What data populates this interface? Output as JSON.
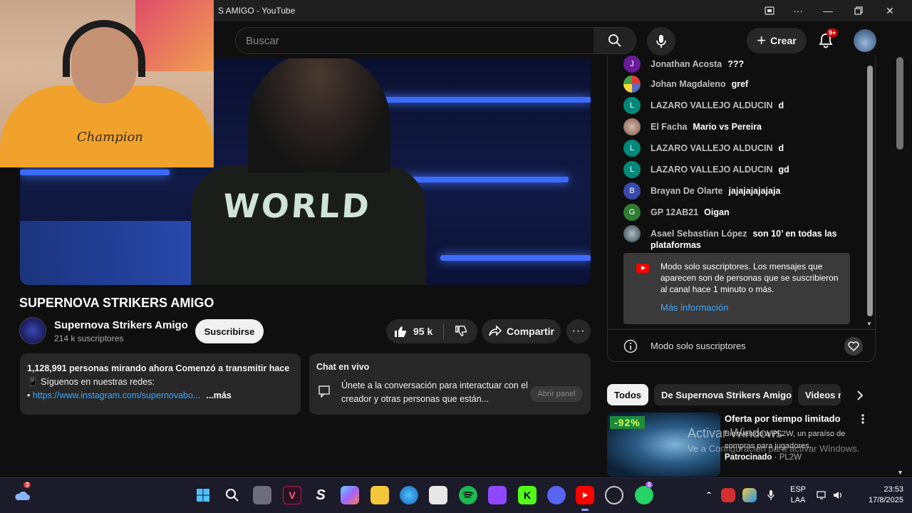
{
  "window": {
    "title": "S AMIGO - YouTube"
  },
  "header": {
    "search_placeholder": "Buscar",
    "create_label": "Crear",
    "notifications_badge": "9+"
  },
  "video": {
    "shirt_text": "WORLD",
    "webcam_brand": "Champion",
    "title": "SUPERNOVA STRIKERS AMIGO",
    "channel_name": "Supernova Strikers Amigo",
    "subscribers": "214 k suscriptores",
    "subscribe_label": "Suscribirse",
    "likes": "95 k",
    "share_label": "Compartir"
  },
  "description": {
    "stats": "1,128,991 personas mirando ahora  Comenzó a transmitir hace",
    "line2": "📱 Síguenos en nuestras redes:",
    "link": "https://www.instagram.com/supernovabo...",
    "more": "...más"
  },
  "chat_panel": {
    "title": "Chat en vivo",
    "message": "Únete a la conversación para interactuar con el creador y otras personas que están...",
    "open_label": "Abrir panel"
  },
  "live_chat": {
    "messages": [
      {
        "initial": "J",
        "author": "Jonathan Acosta",
        "text": "???",
        "color": "#6a1b9a"
      },
      {
        "initial": "",
        "author": "Johan Magdaleno",
        "text": "gref",
        "color": "#5c6bc0"
      },
      {
        "initial": "L",
        "author": "LAZARO VALLEJO ALDUCIN",
        "text": "d",
        "color": "#00897b"
      },
      {
        "initial": "",
        "author": "El Facha",
        "text": "Mario vs Pereira",
        "color": "#a1887f"
      },
      {
        "initial": "L",
        "author": "LAZARO VALLEJO ALDUCIN",
        "text": "d",
        "color": "#00897b"
      },
      {
        "initial": "L",
        "author": "LAZARO VALLEJO ALDUCIN",
        "text": "gd",
        "color": "#00897b"
      },
      {
        "initial": "B",
        "author": "Brayan De Olarte",
        "text": "jajajajajajaja",
        "color": "#3949ab"
      },
      {
        "initial": "G",
        "author": "GP 12AB21",
        "text": "Oigan",
        "color": "#2e7d32"
      },
      {
        "initial": "",
        "author": "Asael Sebastian López",
        "text": "son 10’ en todas las plataformas",
        "color": "#546e7a"
      }
    ],
    "notice_text": "Modo solo suscriptores. Los mensajes que aparecen son de personas que se suscribieron al canal hace 1 minuto o más.",
    "notice_more": "Más información",
    "footer_label": "Modo solo suscriptores"
  },
  "chips": {
    "all": "Todos",
    "channel": "De Supernova Strikers Amigo",
    "videos": "Videos r"
  },
  "ad": {
    "discount": "-92%",
    "title": "Oferta por tiempo limitado",
    "desc": "Bienvenido a PL2W, un paraíso de compras para jugadores.",
    "sponsored": "Patrocinado",
    "sponsor": "PL2W"
  },
  "watermark": {
    "line1": "Activar Windows",
    "line2": "Ve a Configuración para activar Windows."
  },
  "taskbar": {
    "weather_badge": "3",
    "whatsapp_badge": "5",
    "lang_top": "ESP",
    "lang_bottom": "LAA",
    "time": "23:53",
    "date": "17/8/2025"
  }
}
